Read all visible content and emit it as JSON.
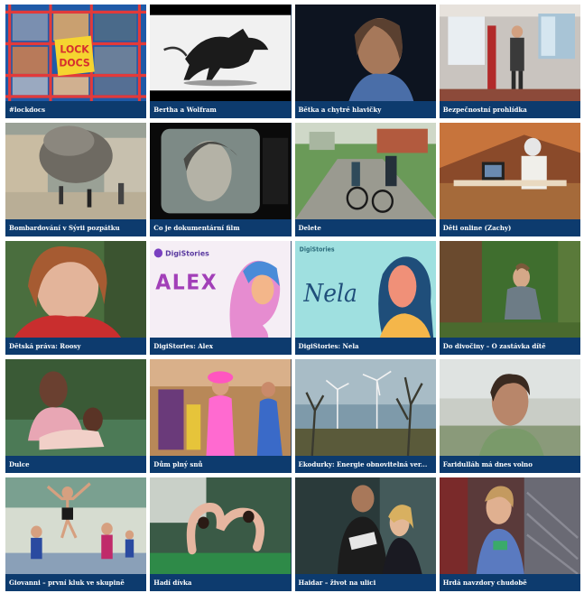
{
  "films": [
    {
      "title": "#lockdocs"
    },
    {
      "title": "Bertha a Wolfram"
    },
    {
      "title": "Bětka a chytré hlavičky"
    },
    {
      "title": "Bezpečnostní prohlídka"
    },
    {
      "title": "Bombardování v Sýrii pozpátku"
    },
    {
      "title": "Co je dokumentární film"
    },
    {
      "title": "Delete"
    },
    {
      "title": "Děti online (Zachy)"
    },
    {
      "title": "Dětská práva: Roosy"
    },
    {
      "title": "DigiStories: Alex"
    },
    {
      "title": "DigiStories: Nela"
    },
    {
      "title": "Do divočiny – O zastávka dítě"
    },
    {
      "title": "Dulce"
    },
    {
      "title": "Dům plný snů"
    },
    {
      "title": "Ekodurky: Energie obnovitelná ver..."
    },
    {
      "title": "Faridulláh má dnes volno"
    },
    {
      "title": "Giovanni – první kluk ve skupině"
    },
    {
      "title": "Hadí dívka"
    },
    {
      "title": "Haidar – život na ulici"
    },
    {
      "title": "Hrdá navzdory chudobě"
    }
  ],
  "thumb_text": {
    "lockdocs_logo": "LOCK DOCS",
    "alex_brand": "DigiStories",
    "alex_word": "ALEX",
    "nela_brand": "DigiStories",
    "nela_word": "Nela"
  },
  "colors": {
    "caption_bg": "#0d3b6e",
    "caption_text": "#ffffff"
  }
}
